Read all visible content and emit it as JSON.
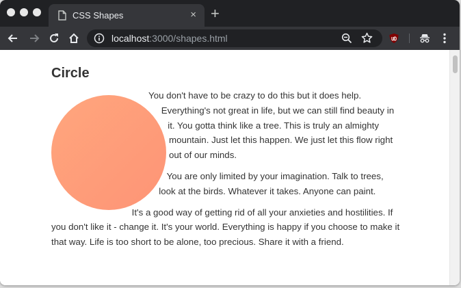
{
  "browser": {
    "tab": {
      "title": "CSS Shapes",
      "close_glyph": "×"
    },
    "new_tab_glyph": "+",
    "address": {
      "host": "localhost",
      "path": ":3000/shapes.html"
    }
  },
  "page": {
    "heading": "Circle",
    "paragraphs": [
      "You don't have to be crazy to do this but it does help. Everything's not great in life, but we can still find beauty in it. You gotta think like a tree. This is truly an almighty mountain. Just let this happen. We just let this flow right out of our minds.",
      "You are only limited by your imagination. Talk to trees, look at the birds. Whatever it takes. Anyone can paint.",
      "It's a good way of getting rid of all your anxieties and hostilities. If you don't like it - change it. It's your world. Everything is happy if you choose to make it that way. Life is too short to be alone, too precious. Share it with a friend."
    ],
    "circle_colors": [
      "#ffa67d",
      "#fe9476"
    ]
  }
}
